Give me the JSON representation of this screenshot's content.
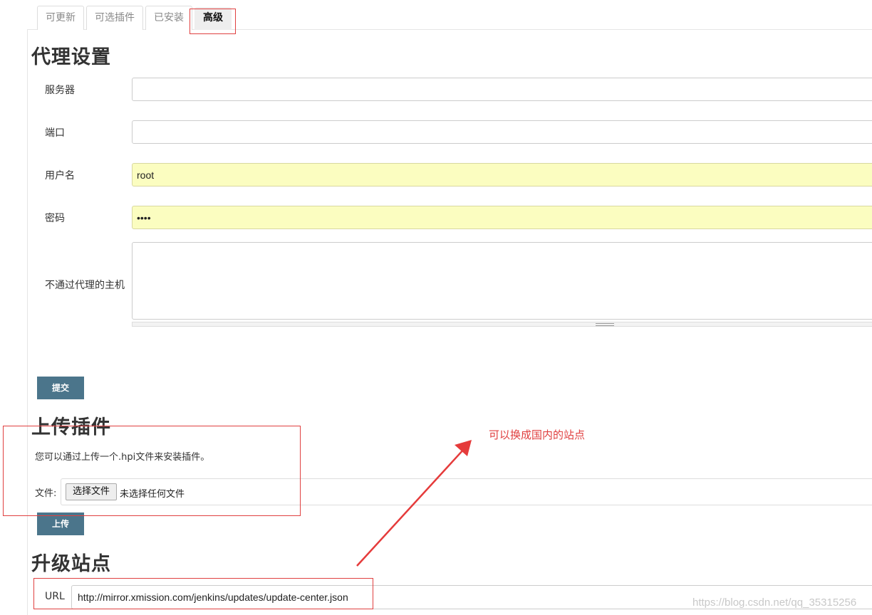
{
  "tabs": [
    {
      "label": "可更新",
      "active": false
    },
    {
      "label": "可选插件",
      "active": false
    },
    {
      "label": "已安装",
      "active": false
    },
    {
      "label": "高级",
      "active": true
    }
  ],
  "proxy": {
    "title": "代理设置",
    "fields": {
      "server": {
        "label": "服务器",
        "value": ""
      },
      "port": {
        "label": "端口",
        "value": ""
      },
      "username": {
        "label": "用户名",
        "value": "root"
      },
      "password": {
        "label": "密码",
        "value": "••••"
      },
      "no_proxy": {
        "label": "不通过代理的主机",
        "value": ""
      }
    },
    "submit_label": "提交"
  },
  "upload": {
    "title": "上传插件",
    "description": "您可以通过上传一个.hpi文件来安装插件。",
    "file_label": "文件:",
    "choose_button": "选择文件",
    "file_status": "未选择任何文件",
    "upload_label": "上传"
  },
  "update_site": {
    "title": "升级站点",
    "url_label": "URL",
    "url_value": "http://mirror.xmission.com/jenkins/updates/update-center.json"
  },
  "annotation": {
    "text": "可以换成国内的站点",
    "color": "#e04040"
  },
  "watermark": "https://blog.csdn.net/qq_35315256",
  "colors": {
    "button": "#4b758b",
    "autofill": "#fbfdc0"
  }
}
